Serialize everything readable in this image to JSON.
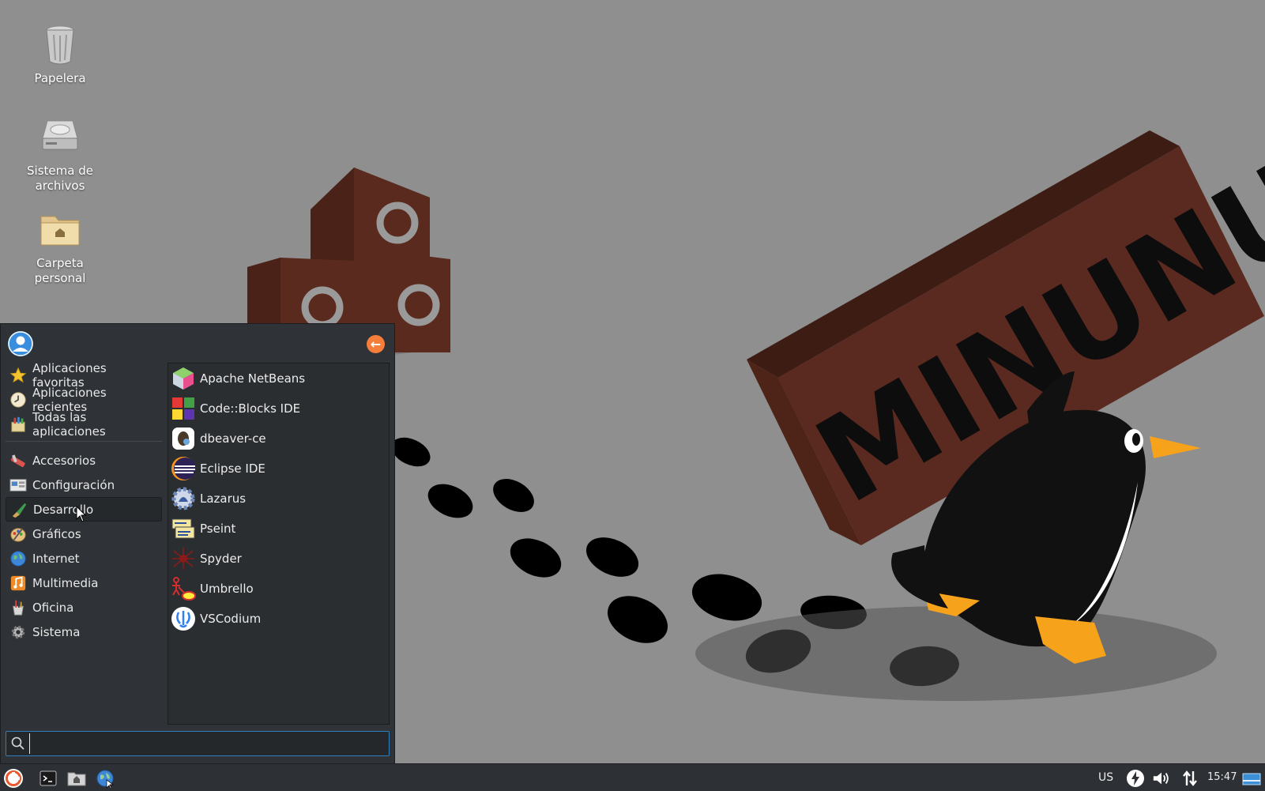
{
  "wallpaper": {
    "logo_text": "MINUNUX"
  },
  "desktop": {
    "icons": [
      {
        "label": "Papelera",
        "icon": "trash-icon"
      },
      {
        "label": "Sistema de archivos",
        "icon": "hard-drive-icon"
      },
      {
        "label": "Carpeta personal",
        "icon": "home-folder-icon"
      }
    ]
  },
  "menu": {
    "back_icon": "arrow-left-icon",
    "categories_top": [
      {
        "label": "Aplicaciones favoritas",
        "icon": "star-icon"
      },
      {
        "label": "Aplicaciones recientes",
        "icon": "clock-icon"
      },
      {
        "label": "Todas las aplicaciones",
        "icon": "apps-icon"
      }
    ],
    "categories": [
      {
        "label": "Accesorios",
        "icon": "accessories-icon"
      },
      {
        "label": "Configuración",
        "icon": "settings-icon"
      },
      {
        "label": "Desarrollo",
        "icon": "development-icon",
        "selected": true
      },
      {
        "label": "Gráficos",
        "icon": "graphics-icon"
      },
      {
        "label": "Internet",
        "icon": "globe-icon"
      },
      {
        "label": "Multimedia",
        "icon": "music-icon"
      },
      {
        "label": "Oficina",
        "icon": "office-icon"
      },
      {
        "label": "Sistema",
        "icon": "system-gear-icon"
      }
    ],
    "apps": [
      {
        "label": "Apache NetBeans",
        "icon": "netbeans-icon"
      },
      {
        "label": "Code::Blocks IDE",
        "icon": "codeblocks-icon"
      },
      {
        "label": "dbeaver-ce",
        "icon": "dbeaver-icon"
      },
      {
        "label": "Eclipse IDE",
        "icon": "eclipse-icon"
      },
      {
        "label": "Lazarus",
        "icon": "lazarus-icon"
      },
      {
        "label": "Pseint",
        "icon": "pseint-icon"
      },
      {
        "label": "Spyder",
        "icon": "spyder-icon"
      },
      {
        "label": "Umbrello",
        "icon": "umbrello-icon"
      },
      {
        "label": "VSCodium",
        "icon": "vscodium-icon"
      }
    ],
    "search": {
      "value": "",
      "placeholder": ""
    }
  },
  "taskbar": {
    "launchers": [
      "whisker-menu-icon",
      "terminal-icon",
      "file-manager-icon",
      "web-browser-icon"
    ],
    "keyboard_layout": "US",
    "clock": "15:47"
  },
  "colors": {
    "desktop_bg": "#8f8f8f",
    "menu_bg": "#2f3337",
    "accent_orange": "#f57e3a",
    "brick": "#5a2a20",
    "penguin_beak": "#f7a21b"
  }
}
